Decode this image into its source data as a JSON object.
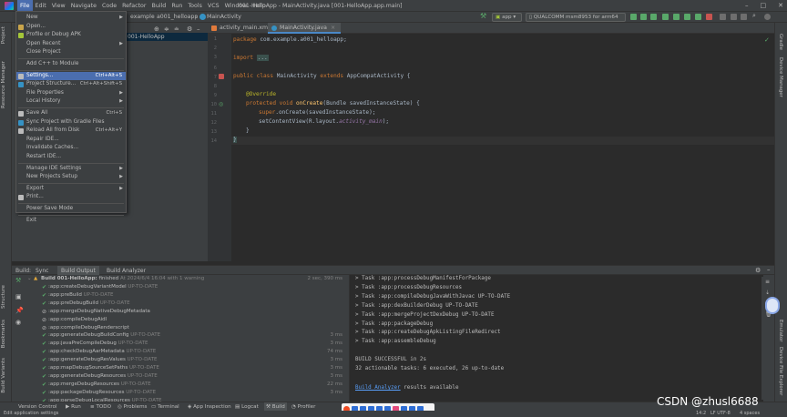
{
  "titlebar": {
    "menus": [
      "File",
      "Edit",
      "View",
      "Navigate",
      "Code",
      "Refactor",
      "Build",
      "Run",
      "Tools",
      "VCS",
      "Window",
      "Help"
    ],
    "title": "001-HelloApp - MainActivity.java [001-HelloApp.app.main]",
    "min": "–",
    "max": "□",
    "close": "✕"
  },
  "navbar": {
    "crumbs": [
      "example",
      "a001_helloapp",
      "MainActivity"
    ],
    "run_config": "app",
    "device": "QUALCOMM msm8953 for arm64"
  },
  "project": {
    "row": "001-HelloApp"
  },
  "tabs": [
    {
      "label": "activity_main.xml",
      "active": false
    },
    {
      "label": "MainActivity.java",
      "active": true
    }
  ],
  "editor": {
    "line_numbers": [
      "1",
      "2",
      "3",
      "",
      "6",
      "7",
      "8",
      "9",
      "10",
      "11",
      "12",
      "13",
      "14"
    ],
    "lines": {
      "l1_kw": "package",
      "l1_rest": " com.example.a001_helloapp;",
      "l3_kw": "import",
      "l3_fold": "...",
      "l7_kw": "public class",
      "l7_name": " MainActivity ",
      "l7_kw2": "extends",
      "l7_rest": " AppCompatActivity {",
      "l9": "@Override",
      "l10_kw": "protected void",
      "l10_fn": " onCreate",
      "l10_rest": "(Bundle savedInstanceState) {",
      "l11_kw": "super",
      "l11_rest": ".onCreate(savedInstanceState);",
      "l12_a": "setContentView(R.layout.",
      "l12_f": "activity_main",
      "l12_b": ");",
      "l13": "}",
      "l14": "}"
    }
  },
  "filemenu": {
    "items": [
      {
        "label": "New",
        "shortcut": "",
        "arrow": true,
        "icon": "",
        "sel": false
      },
      {
        "label": "Open...",
        "shortcut": "",
        "arrow": false,
        "icon": "folder-icon",
        "sel": false
      },
      {
        "label": "Profile or Debug APK",
        "shortcut": "",
        "arrow": false,
        "icon": "apk-icon",
        "sel": false
      },
      {
        "label": "Open Recent",
        "shortcut": "",
        "arrow": true,
        "icon": "",
        "sel": false
      },
      {
        "label": "Close Project",
        "shortcut": "",
        "arrow": false,
        "icon": "",
        "sel": false
      },
      {
        "sep": true
      },
      {
        "label": "Add C++ to Module",
        "shortcut": "",
        "arrow": false,
        "icon": "",
        "sel": false
      },
      {
        "sep": true
      },
      {
        "label": "Settings...",
        "shortcut": "Ctrl+Alt+S",
        "arrow": false,
        "icon": "wrench-icon",
        "sel": true
      },
      {
        "label": "Project Structure...",
        "shortcut": "Ctrl+Alt+Shift+S",
        "arrow": false,
        "icon": "structure-icon",
        "sel": false
      },
      {
        "label": "File Properties",
        "shortcut": "",
        "arrow": true,
        "icon": "",
        "sel": false
      },
      {
        "label": "Local History",
        "shortcut": "",
        "arrow": true,
        "icon": "",
        "sel": false
      },
      {
        "sep": true
      },
      {
        "label": "Save All",
        "shortcut": "Ctrl+S",
        "arrow": false,
        "icon": "save-icon",
        "sel": false
      },
      {
        "label": "Sync Project with Gradle Files",
        "shortcut": "",
        "arrow": false,
        "icon": "sync-icon",
        "sel": false
      },
      {
        "label": "Reload All from Disk",
        "shortcut": "Ctrl+Alt+Y",
        "arrow": false,
        "icon": "reload-icon",
        "sel": false
      },
      {
        "label": "Repair IDE...",
        "shortcut": "",
        "arrow": false,
        "icon": "",
        "sel": false
      },
      {
        "label": "Invalidate Caches...",
        "shortcut": "",
        "arrow": false,
        "icon": "",
        "sel": false
      },
      {
        "label": "Restart IDE...",
        "shortcut": "",
        "arrow": false,
        "icon": "",
        "sel": false
      },
      {
        "sep": true
      },
      {
        "label": "Manage IDE Settings",
        "shortcut": "",
        "arrow": true,
        "icon": "",
        "sel": false
      },
      {
        "label": "New Projects Setup",
        "shortcut": "",
        "arrow": true,
        "icon": "",
        "sel": false
      },
      {
        "sep": true
      },
      {
        "label": "Export",
        "shortcut": "",
        "arrow": true,
        "icon": "",
        "sel": false
      },
      {
        "label": "Print...",
        "shortcut": "",
        "arrow": false,
        "icon": "print-icon",
        "sel": false
      },
      {
        "sep": true
      },
      {
        "label": "Power Save Mode",
        "shortcut": "",
        "arrow": false,
        "icon": "",
        "sel": false
      },
      {
        "sep": true
      },
      {
        "label": "Exit",
        "shortcut": "",
        "arrow": false,
        "icon": "",
        "sel": false
      }
    ]
  },
  "build": {
    "tabs": [
      "Build:",
      "Sync",
      "Build Output",
      "Build Analyzer"
    ],
    "header": {
      "label": "Build 001-HelloApp:",
      "status": "finished",
      "rest": "At 2024/6/4 16:04 with 1 warning",
      "time": "2 sec, 390 ms"
    },
    "tasks": [
      {
        "name": ":app:createDebugVariantModel",
        "state": "UP-TO-DATE",
        "time": ""
      },
      {
        "name": ":app:preBuild",
        "state": "UP-TO-DATE",
        "time": ""
      },
      {
        "name": ":app:preDebugBuild",
        "state": "UP-TO-DATE",
        "time": ""
      },
      {
        "name": ":app:mergeDebugNativeDebugMetadata",
        "state": "",
        "time": ""
      },
      {
        "name": ":app:compileDebugAidl",
        "state": "",
        "time": ""
      },
      {
        "name": ":app:compileDebugRenderscript",
        "state": "",
        "time": ""
      },
      {
        "name": ":app:generateDebugBuildConfig",
        "state": "UP-TO-DATE",
        "time": "3 ms"
      },
      {
        "name": ":app:javaPreCompileDebug",
        "state": "UP-TO-DATE",
        "time": "3 ms"
      },
      {
        "name": ":app:checkDebugAarMetadata",
        "state": "UP-TO-DATE",
        "time": "74 ms"
      },
      {
        "name": ":app:generateDebugResValues",
        "state": "UP-TO-DATE",
        "time": "3 ms"
      },
      {
        "name": ":app:mapDebugSourceSetPaths",
        "state": "UP-TO-DATE",
        "time": "3 ms"
      },
      {
        "name": ":app:generateDebugResources",
        "state": "UP-TO-DATE",
        "time": "3 ms"
      },
      {
        "name": ":app:mergeDebugResources",
        "state": "UP-TO-DATE",
        "time": "22 ms"
      },
      {
        "name": ":app:packageDebugResources",
        "state": "UP-TO-DATE",
        "time": "3 ms"
      },
      {
        "name": ":app:parseDebugLocalResources",
        "state": "UP-TO-DATE",
        "time": ""
      }
    ],
    "output": [
      "> Task :app:processDebugManifestForPackage",
      "> Task :app:processDebugResources",
      "> Task :app:compileDebugJavaWithJavac UP-TO-DATE",
      "> Task :app:dexBuilderDebug UP-TO-DATE",
      "> Task :app:mergeProjectDexDebug UP-TO-DATE",
      "> Task :app:packageDebug",
      "> Task :app:createDebugApkListingFileRedirect",
      "> Task :app:assembleDebug",
      "",
      "BUILD SUCCESSFUL in 2s",
      "32 actionable tasks: 6 executed, 26 up-to-date",
      ""
    ],
    "analyzer_link": "Build Analyzer",
    "analyzer_rest": " results available"
  },
  "bottom_tools": [
    "Version Control",
    "Run",
    "TODO",
    "Problems",
    "Terminal",
    "App Inspection",
    "Logcat",
    "Build",
    "Profiler"
  ],
  "left_strip": [
    "Project",
    "Resource Manager",
    "Structure",
    "Bookmarks",
    "Build Variants"
  ],
  "right_strip": [
    "Gradle",
    "Device Manager",
    "Emulator",
    "Device File Explorer"
  ],
  "status": {
    "left": "Edit application settings",
    "pos": "14:2",
    "enc": "LF  UTF-8",
    "indent": "4 spaces"
  },
  "watermark": "CSDN @zhusl6688"
}
